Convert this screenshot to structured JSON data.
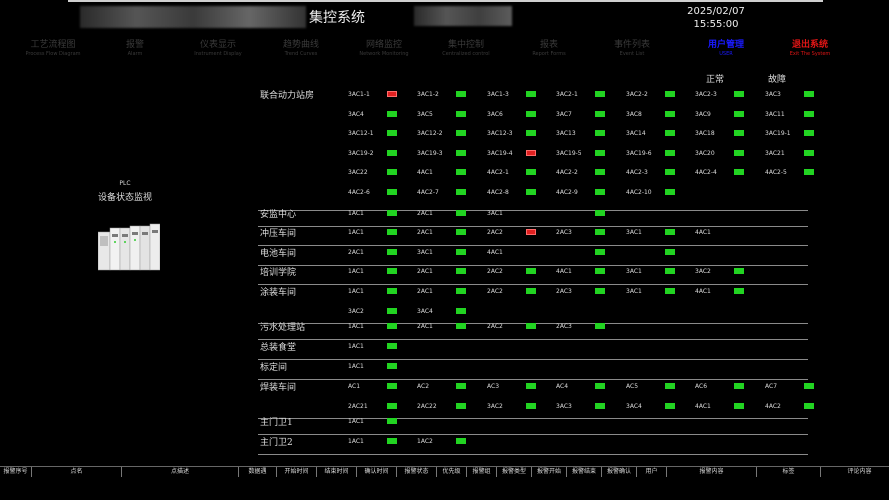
{
  "header": {
    "title": "集控系统",
    "date": "2025/02/07",
    "time": "15:55:00"
  },
  "nav": [
    {
      "cn": "工艺流程图",
      "en": "Process Flow Diagram",
      "key": "process-flow"
    },
    {
      "cn": "报警",
      "en": "Alarm",
      "key": "alarm"
    },
    {
      "cn": "仪表显示",
      "en": "Instrument Display",
      "key": "instrument-display"
    },
    {
      "cn": "趋势曲线",
      "en": "Trend Curves",
      "key": "trend-curves"
    },
    {
      "cn": "网络监控",
      "en": "Network Monitoring",
      "key": "network-monitoring"
    },
    {
      "cn": "集中控制",
      "en": "Centralized control",
      "key": "centralized-control"
    },
    {
      "cn": "报表",
      "en": "Report Forms",
      "key": "report-forms"
    },
    {
      "cn": "事件列表",
      "en": "Event List",
      "key": "event-list"
    },
    {
      "cn": "用户管理",
      "en": "USER",
      "key": "user-management"
    },
    {
      "cn": "退出系统",
      "en": "Exit The System",
      "key": "exit-system"
    }
  ],
  "legend": {
    "normal": "正常",
    "fault": "故障"
  },
  "colors": {
    "normal": "#22d422",
    "fault": "#e02020",
    "user": "#1a1aff",
    "exit": "#e01515"
  },
  "plc": {
    "title": "PLC",
    "subtitle": "设备状态监视",
    "icon": "plc-rack-icon"
  },
  "sections": [
    {
      "name": "联合动力站房",
      "rows": [
        [
          {
            "n": "3AC1-1",
            "s": "fault"
          },
          {
            "n": "3AC1-2",
            "s": "ok"
          },
          {
            "n": "3AC1-3",
            "s": "ok"
          },
          {
            "n": "3AC2-1",
            "s": "ok"
          },
          {
            "n": "3AC2-2",
            "s": "ok"
          },
          {
            "n": "3AC2-3",
            "s": "ok"
          },
          {
            "n": "3AC3",
            "s": "ok"
          }
        ],
        [
          {
            "n": "3AC4",
            "s": "ok"
          },
          {
            "n": "3AC5",
            "s": "ok"
          },
          {
            "n": "3AC6",
            "s": "ok"
          },
          {
            "n": "3AC7",
            "s": "ok"
          },
          {
            "n": "3AC8",
            "s": "ok"
          },
          {
            "n": "3AC9",
            "s": "ok"
          },
          {
            "n": "3AC11",
            "s": "ok"
          }
        ],
        [
          {
            "n": "3AC12-1",
            "s": "ok"
          },
          {
            "n": "3AC12-2",
            "s": "ok"
          },
          {
            "n": "3AC12-3",
            "s": "ok"
          },
          {
            "n": "3AC13",
            "s": "ok"
          },
          {
            "n": "3AC14",
            "s": "ok"
          },
          {
            "n": "3AC18",
            "s": "ok"
          },
          {
            "n": "3AC19-1",
            "s": "ok"
          }
        ],
        [
          {
            "n": "3AC19-2",
            "s": "ok"
          },
          {
            "n": "3AC19-3",
            "s": "ok"
          },
          {
            "n": "3AC19-4",
            "s": "fault"
          },
          {
            "n": "3AC19-5",
            "s": "ok"
          },
          {
            "n": "3AC19-6",
            "s": "ok"
          },
          {
            "n": "3AC20",
            "s": "ok"
          },
          {
            "n": "3AC21",
            "s": "ok"
          }
        ],
        [
          {
            "n": "3AC22",
            "s": "ok"
          },
          {
            "n": "4AC1",
            "s": "ok"
          },
          {
            "n": "4AC2-1",
            "s": "ok"
          },
          {
            "n": "4AC2-2",
            "s": "ok"
          },
          {
            "n": "4AC2-3",
            "s": "ok"
          },
          {
            "n": "4AC2-4",
            "s": "ok"
          },
          {
            "n": "4AC2-5",
            "s": "ok"
          }
        ],
        [
          {
            "n": "4AC2-6",
            "s": "ok"
          },
          {
            "n": "4AC2-7",
            "s": "ok"
          },
          {
            "n": "4AC2-8",
            "s": "ok"
          },
          {
            "n": "4AC2-9",
            "s": "ok"
          },
          {
            "n": "4AC2-10",
            "s": "ok"
          }
        ]
      ]
    },
    {
      "name": "安监中心",
      "rows": [
        [
          {
            "n": "1AC1",
            "s": "ok"
          },
          {
            "n": "2AC1",
            "s": "ok"
          },
          {
            "n": "3AC1",
            "s": "none"
          },
          {
            "n": "",
            "s": "ok"
          }
        ]
      ]
    },
    {
      "name": "冲压车间",
      "rows": [
        [
          {
            "n": "1AC1",
            "s": "ok"
          },
          {
            "n": "2AC1",
            "s": "ok"
          },
          {
            "n": "2AC2",
            "s": "fault"
          },
          {
            "n": "2AC3",
            "s": "ok"
          },
          {
            "n": "3AC1",
            "s": "ok"
          },
          {
            "n": "4AC1",
            "s": "none"
          }
        ]
      ]
    },
    {
      "name": "电池车间",
      "rows": [
        [
          {
            "n": "2AC1",
            "s": "ok"
          },
          {
            "n": "3AC1",
            "s": "ok"
          },
          {
            "n": "4AC1",
            "s": "none"
          },
          {
            "n": "",
            "s": "ok"
          },
          {
            "n": "",
            "s": "ok"
          }
        ]
      ]
    },
    {
      "name": "培训学院",
      "rows": [
        [
          {
            "n": "1AC1",
            "s": "ok"
          },
          {
            "n": "2AC1",
            "s": "ok"
          },
          {
            "n": "2AC2",
            "s": "ok"
          },
          {
            "n": "4AC1",
            "s": "ok"
          },
          {
            "n": "3AC1",
            "s": "ok"
          },
          {
            "n": "3AC2",
            "s": "ok"
          }
        ]
      ]
    },
    {
      "name": "涂装车间",
      "rows": [
        [
          {
            "n": "1AC1",
            "s": "ok"
          },
          {
            "n": "2AC1",
            "s": "ok"
          },
          {
            "n": "2AC2",
            "s": "ok"
          },
          {
            "n": "2AC3",
            "s": "ok"
          },
          {
            "n": "3AC1",
            "s": "ok"
          },
          {
            "n": "4AC1",
            "s": "ok"
          }
        ],
        [
          {
            "n": "3AC2",
            "s": "ok"
          },
          {
            "n": "3AC4",
            "s": "ok"
          }
        ]
      ]
    },
    {
      "name": "污水处理站",
      "rows": [
        [
          {
            "n": "1AC1",
            "s": "ok"
          },
          {
            "n": "2AC1",
            "s": "ok"
          },
          {
            "n": "2AC2",
            "s": "ok"
          },
          {
            "n": "2AC3",
            "s": "ok"
          }
        ]
      ]
    },
    {
      "name": "总装食堂",
      "rows": [
        [
          {
            "n": "1AC1",
            "s": "ok"
          }
        ]
      ]
    },
    {
      "name": "标定间",
      "rows": [
        [
          {
            "n": "1AC1",
            "s": "ok"
          }
        ]
      ]
    },
    {
      "name": "焊装车间",
      "rows": [
        [
          {
            "n": "AC1",
            "s": "ok"
          },
          {
            "n": "AC2",
            "s": "ok"
          },
          {
            "n": "AC3",
            "s": "ok"
          },
          {
            "n": "AC4",
            "s": "ok"
          },
          {
            "n": "AC5",
            "s": "ok"
          },
          {
            "n": "AC6",
            "s": "ok"
          },
          {
            "n": "AC7",
            "s": "ok"
          }
        ],
        [
          {
            "n": "2AC21",
            "s": "ok"
          },
          {
            "n": "2AC22",
            "s": "ok"
          },
          {
            "n": "3AC2",
            "s": "ok"
          },
          {
            "n": "3AC3",
            "s": "ok"
          },
          {
            "n": "3AC4",
            "s": "ok"
          },
          {
            "n": "4AC1",
            "s": "ok"
          },
          {
            "n": "4AC2",
            "s": "ok"
          }
        ]
      ]
    },
    {
      "name": "主门卫1",
      "rows": [
        [
          {
            "n": "1AC1",
            "s": "ok"
          }
        ]
      ]
    },
    {
      "name": "主门卫2",
      "rows": [
        [
          {
            "n": "1AC1",
            "s": "ok"
          },
          {
            "n": "1AC2",
            "s": "ok"
          }
        ]
      ]
    }
  ],
  "alarm_columns": [
    "报警序号",
    "点名",
    "点描述",
    "数据遇",
    "开始时间",
    "结束时间",
    "确认时间",
    "报警状态",
    "优先级",
    "报警组",
    "报警类型",
    "报警开始",
    "报警结束",
    "报警确认",
    "用户",
    "报警内容",
    "标签",
    "评论内容"
  ]
}
